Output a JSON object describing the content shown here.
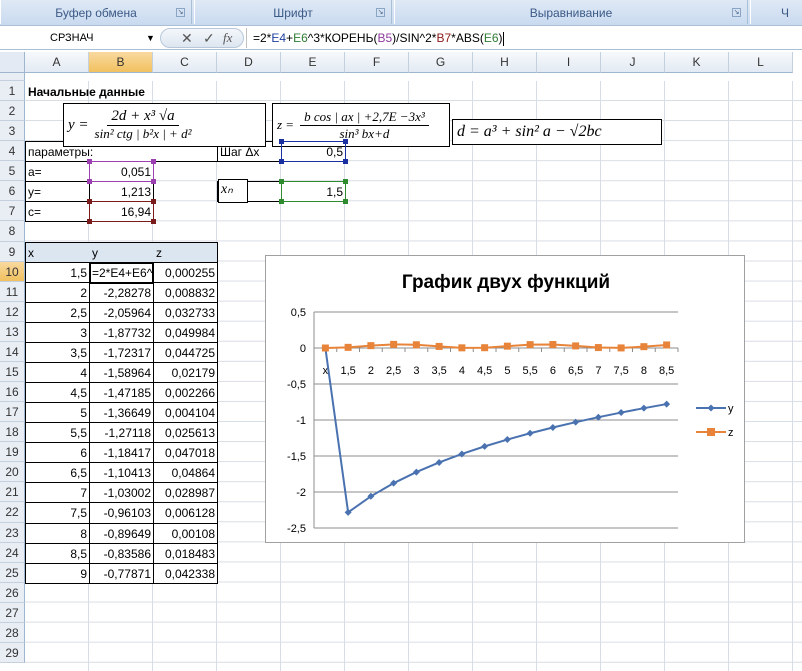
{
  "ribbon": {
    "groups": [
      "Буфер обмена",
      "Шрифт",
      "Выравнивание",
      "Ч"
    ]
  },
  "formula_bar": {
    "name_box": "СРЗНАЧ",
    "fx": "fx",
    "cancel": "✕",
    "enter": "✓",
    "formula_parts": [
      {
        "t": "=2*",
        "c": "#000"
      },
      {
        "t": "E4",
        "c": "#1f3fa0"
      },
      {
        "t": "+",
        "c": "#000"
      },
      {
        "t": "E6",
        "c": "#2e7d32"
      },
      {
        "t": "^3*КОРЕНЬ(",
        "c": "#000"
      },
      {
        "t": "B5",
        "c": "#8e3a9e"
      },
      {
        "t": ")/SIN^2*",
        "c": "#000"
      },
      {
        "t": "B7",
        "c": "#8b1a1a"
      },
      {
        "t": "*ABS(",
        "c": "#000"
      },
      {
        "t": "E6",
        "c": "#2e7d32"
      },
      {
        "t": ")",
        "c": "#000"
      }
    ]
  },
  "columns": [
    "A",
    "B",
    "C",
    "D",
    "E",
    "F",
    "G",
    "H",
    "I",
    "J",
    "K",
    "L"
  ],
  "selected_column": "B",
  "selected_row": 10,
  "rows_count": 29,
  "formulas": {
    "y": {
      "lhs": "y =",
      "num": "2d + x³ √a",
      "den": "sin² ctg | b²x | + d²"
    },
    "z": {
      "lhs": "z =",
      "num": "b cos | ax | +2,7E −3x³",
      "den": "sin³ bx+d"
    },
    "d": {
      "text": "d = a³ + sin² a − √2bc"
    }
  },
  "cells": [
    {
      "a": "A1",
      "v": "Начальные данные",
      "bold": true
    },
    {
      "a": "A4",
      "v": "параметры:"
    },
    {
      "a": "A5",
      "v": "a="
    },
    {
      "a": "B5",
      "v": "0,051",
      "num": true
    },
    {
      "a": "A6",
      "v": "y="
    },
    {
      "a": "B6",
      "v": "1,213",
      "num": true
    },
    {
      "a": "A7",
      "v": "c="
    },
    {
      "a": "B7",
      "v": "16,94",
      "num": true
    },
    {
      "a": "D4",
      "v": "Шаг Δx"
    },
    {
      "a": "E4",
      "v": "0,5",
      "num": true
    },
    {
      "a": "D6",
      "v": "xₙ",
      "serif": true
    },
    {
      "a": "E6",
      "v": "1,5",
      "num": true
    },
    {
      "a": "A9",
      "v": "x",
      "hdr": true
    },
    {
      "a": "B9",
      "v": "y",
      "hdr": true
    },
    {
      "a": "C9",
      "v": "z",
      "hdr": true
    },
    {
      "a": "A10",
      "v": "1,5",
      "num": true
    },
    {
      "a": "B10",
      "v": "=2*E4+E6^",
      "edit": true
    },
    {
      "a": "C10",
      "v": "0,000255",
      "num": true
    },
    {
      "a": "A11",
      "v": "2",
      "num": true
    },
    {
      "a": "B11",
      "v": "-2,28278",
      "num": true
    },
    {
      "a": "C11",
      "v": "0,008832",
      "num": true
    },
    {
      "a": "A12",
      "v": "2,5",
      "num": true
    },
    {
      "a": "B12",
      "v": "-2,05964",
      "num": true
    },
    {
      "a": "C12",
      "v": "0,032733",
      "num": true
    },
    {
      "a": "A13",
      "v": "3",
      "num": true
    },
    {
      "a": "B13",
      "v": "-1,87732",
      "num": true
    },
    {
      "a": "C13",
      "v": "0,049984",
      "num": true
    },
    {
      "a": "A14",
      "v": "3,5",
      "num": true
    },
    {
      "a": "B14",
      "v": "-1,72317",
      "num": true
    },
    {
      "a": "C14",
      "v": "0,044725",
      "num": true
    },
    {
      "a": "A15",
      "v": "4",
      "num": true
    },
    {
      "a": "B15",
      "v": "-1,58964",
      "num": true
    },
    {
      "a": "C15",
      "v": "0,02179",
      "num": true
    },
    {
      "a": "A16",
      "v": "4,5",
      "num": true
    },
    {
      "a": "B16",
      "v": "-1,47185",
      "num": true
    },
    {
      "a": "C16",
      "v": "0,002266",
      "num": true
    },
    {
      "a": "A17",
      "v": "5",
      "num": true
    },
    {
      "a": "B17",
      "v": "-1,36649",
      "num": true
    },
    {
      "a": "C17",
      "v": "0,004104",
      "num": true
    },
    {
      "a": "A18",
      "v": "5,5",
      "num": true
    },
    {
      "a": "B18",
      "v": "-1,27118",
      "num": true
    },
    {
      "a": "C18",
      "v": "0,025613",
      "num": true
    },
    {
      "a": "A19",
      "v": "6",
      "num": true
    },
    {
      "a": "B19",
      "v": "-1,18417",
      "num": true
    },
    {
      "a": "C19",
      "v": "0,047018",
      "num": true
    },
    {
      "a": "A20",
      "v": "6,5",
      "num": true
    },
    {
      "a": "B20",
      "v": "-1,10413",
      "num": true
    },
    {
      "a": "C20",
      "v": "0,04864",
      "num": true
    },
    {
      "a": "A21",
      "v": "7",
      "num": true
    },
    {
      "a": "B21",
      "v": "-1,03002",
      "num": true
    },
    {
      "a": "C21",
      "v": "0,028987",
      "num": true
    },
    {
      "a": "A22",
      "v": "7,5",
      "num": true
    },
    {
      "a": "B22",
      "v": "-0,96103",
      "num": true
    },
    {
      "a": "C22",
      "v": "0,006128",
      "num": true
    },
    {
      "a": "A23",
      "v": "8",
      "num": true
    },
    {
      "a": "B23",
      "v": "-0,89649",
      "num": true
    },
    {
      "a": "C23",
      "v": "0,00108",
      "num": true
    },
    {
      "a": "A24",
      "v": "8,5",
      "num": true
    },
    {
      "a": "B24",
      "v": "-0,83586",
      "num": true
    },
    {
      "a": "C24",
      "v": "0,018483",
      "num": true
    },
    {
      "a": "A25",
      "v": "9",
      "num": true
    },
    {
      "a": "B25",
      "v": "-0,77871",
      "num": true
    },
    {
      "a": "C25",
      "v": "0,042338",
      "num": true
    }
  ],
  "ref_colors": {
    "B5": "#9c3fb0",
    "B7": "#7a1c1c",
    "E4": "#1a2fa0",
    "E6": "#2e8b2e"
  },
  "chart_data": {
    "type": "line",
    "title": "График двух функций",
    "categories": [
      "x",
      "1,5",
      "2",
      "2,5",
      "3",
      "3,5",
      "4",
      "4,5",
      "5",
      "5,5",
      "6",
      "6,5",
      "7",
      "7,5",
      "8",
      "8,5"
    ],
    "ylim": [
      -2.5,
      0.5
    ],
    "yticks": [
      0.5,
      0,
      -0.5,
      -1,
      -1.5,
      -2,
      -2.5
    ],
    "ytick_labels": [
      "0,5",
      "0",
      "-0,5",
      "-1",
      "-1,5",
      "-2",
      "-2,5"
    ],
    "grid": true,
    "legend": "right",
    "series": [
      {
        "name": "y",
        "color": "#4a72b0",
        "marker": "diamond",
        "values": [
          0,
          -2.28278,
          -2.05964,
          -1.87732,
          -1.72317,
          -1.58964,
          -1.47185,
          -1.36649,
          -1.27118,
          -1.18417,
          -1.10413,
          -1.03002,
          -0.96103,
          -0.89649,
          -0.83586,
          -0.77871
        ]
      },
      {
        "name": "z",
        "color": "#e8843a",
        "marker": "square",
        "values": [
          0,
          0.008832,
          0.032733,
          0.049984,
          0.044725,
          0.02179,
          0.002266,
          0.004104,
          0.025613,
          0.047018,
          0.04864,
          0.028987,
          0.006128,
          0.00108,
          0.018483,
          0.042338
        ]
      }
    ]
  }
}
